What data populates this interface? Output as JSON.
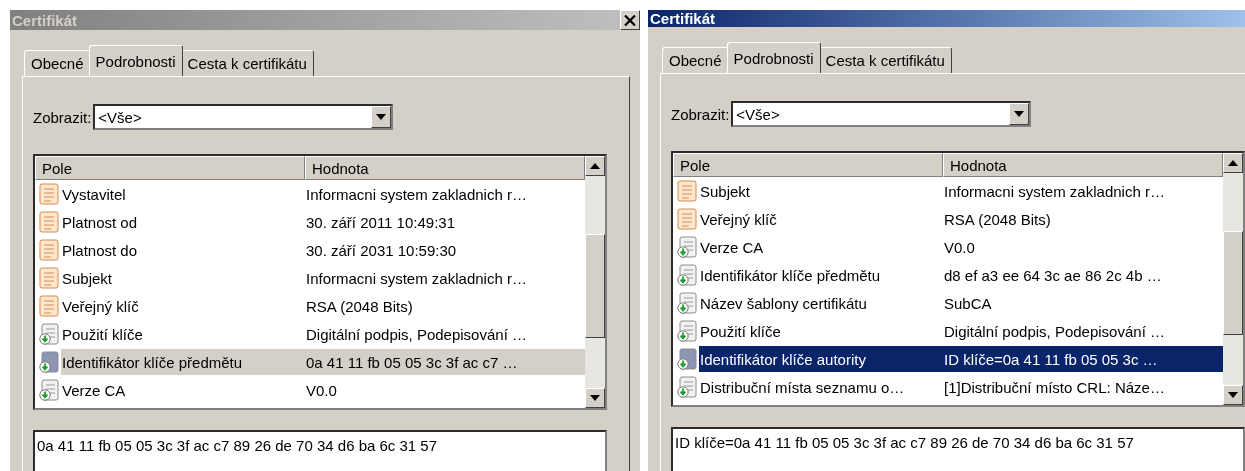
{
  "windows": [
    {
      "title": "Certifikát",
      "active": false,
      "close_button": true,
      "tabs": [
        {
          "label": "Obecné",
          "selected": false
        },
        {
          "label": "Podrobnosti",
          "selected": true
        },
        {
          "label": "Cesta k certifikátu",
          "selected": false
        }
      ],
      "view_label": "Zobrazit:",
      "view_value": "<Vše>",
      "columns": [
        "Pole",
        "Hodnota"
      ],
      "rows": [
        {
          "kind": "field",
          "field": "Vystavitel",
          "value": "Informacni system zakladnich r…",
          "selected": false
        },
        {
          "kind": "field",
          "field": "Platnost od",
          "value": "30. září 2011 10:49:31",
          "selected": false
        },
        {
          "kind": "field",
          "field": "Platnost do",
          "value": "30. září 2031 10:59:30",
          "selected": false
        },
        {
          "kind": "field",
          "field": "Subjekt",
          "value": "Informacni system zakladnich r…",
          "selected": false
        },
        {
          "kind": "field",
          "field": "Veřejný klíč",
          "value": "RSA (2048 Bits)",
          "selected": false
        },
        {
          "kind": "extension",
          "field": "Použití klíče",
          "value": "Digitální podpis, Podepisování …",
          "selected": false
        },
        {
          "kind": "extension",
          "field": "Identifikátor klíče předmětu",
          "value": "0a 41 11 fb 05 05 3c 3f ac c7 …",
          "selected": true
        },
        {
          "kind": "extension",
          "field": "Verze CA",
          "value": "V0.0",
          "selected": false
        }
      ],
      "detail": "0a 41 11 fb 05 05 3c 3f ac c7 89 26 de 70 34 d6 ba 6c 31 57"
    },
    {
      "title": "Certifikát",
      "active": true,
      "close_button": false,
      "tabs": [
        {
          "label": "Obecné",
          "selected": false
        },
        {
          "label": "Podrobnosti",
          "selected": true
        },
        {
          "label": "Cesta k certifikátu",
          "selected": false
        }
      ],
      "view_label": "Zobrazit:",
      "view_value": "<Vše>",
      "columns": [
        "Pole",
        "Hodnota"
      ],
      "rows": [
        {
          "kind": "field",
          "field": "Subjekt",
          "value": "Informacni system zakladnich r…",
          "selected": false
        },
        {
          "kind": "field",
          "field": "Veřejný klíč",
          "value": "RSA (2048 Bits)",
          "selected": false
        },
        {
          "kind": "extension",
          "field": "Verze CA",
          "value": "V0.0",
          "selected": false
        },
        {
          "kind": "extension",
          "field": "Identifikátor klíče předmětu",
          "value": "d8 ef a3 ee 64 3c ae 86 2c 4b …",
          "selected": false
        },
        {
          "kind": "extension",
          "field": "Název šablony certifikátu",
          "value": "SubCA",
          "selected": false
        },
        {
          "kind": "extension",
          "field": "Použití klíče",
          "value": "Digitální podpis, Podepisování …",
          "selected": false
        },
        {
          "kind": "extension",
          "field": "Identifikátor klíče autority",
          "value": "ID klíče=0a 41 11 fb 05 05 3c …",
          "selected": true
        },
        {
          "kind": "extension",
          "field": "Distribuční místa seznamu o…",
          "value": "[1]Distribuční místo CRL: Náze…",
          "selected": false
        }
      ],
      "detail": "ID klíče=0a 41 11 fb 05 05 3c 3f ac c7 89 26 de 70 34 d6 ba 6c 31 57"
    }
  ]
}
